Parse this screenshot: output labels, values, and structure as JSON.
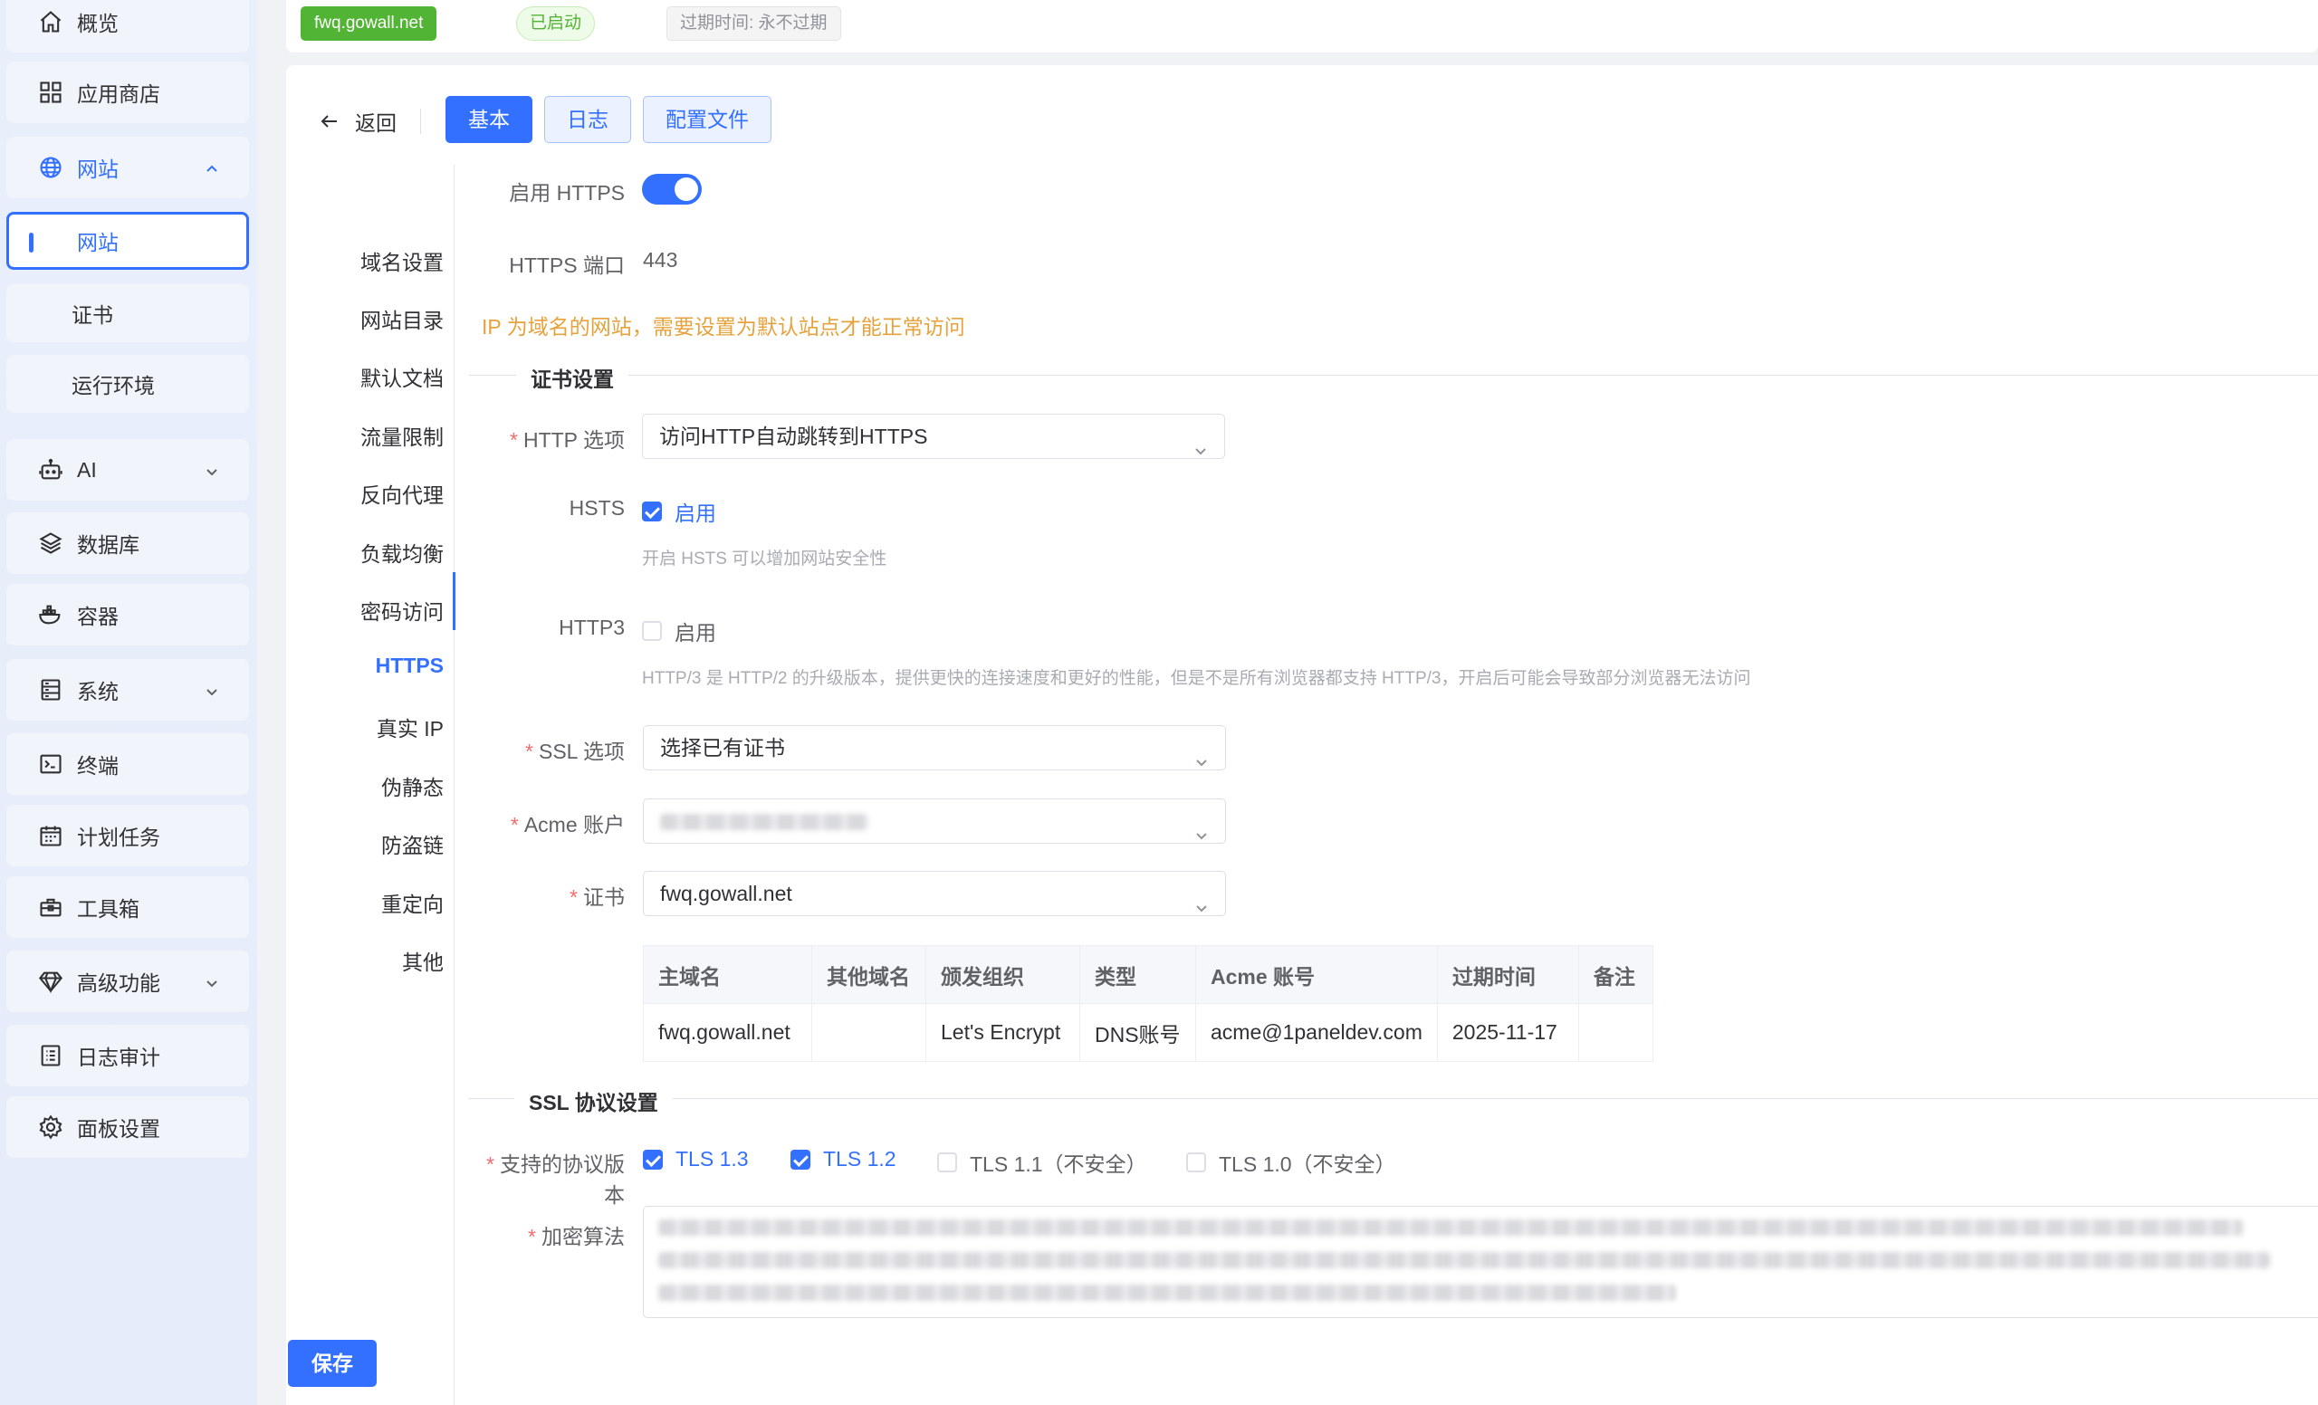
{
  "sidebar": {
    "items": [
      {
        "label": "概览",
        "icon": "home-icon"
      },
      {
        "label": "应用商店",
        "icon": "grid-icon"
      },
      {
        "label": "网站",
        "icon": "globe-icon"
      },
      {
        "label": "AI",
        "icon": "robot-icon"
      },
      {
        "label": "数据库",
        "icon": "layers-icon"
      },
      {
        "label": "容器",
        "icon": "docker-icon"
      },
      {
        "label": "系统",
        "icon": "server-icon"
      },
      {
        "label": "终端",
        "icon": "terminal-icon"
      },
      {
        "label": "计划任务",
        "icon": "calendar-icon"
      },
      {
        "label": "工具箱",
        "icon": "toolbox-icon"
      },
      {
        "label": "高级功能",
        "icon": "diamond-icon"
      },
      {
        "label": "日志审计",
        "icon": "log-icon"
      },
      {
        "label": "面板设置",
        "icon": "gear-icon"
      }
    ],
    "sub_items": [
      {
        "label": "网站"
      },
      {
        "label": "证书"
      },
      {
        "label": "运行环境"
      }
    ]
  },
  "topbar": {
    "domain": "fwq.gowall.net",
    "status": "已启动",
    "expire": "过期时间: 永不过期"
  },
  "panel": {
    "back_label": "返回",
    "tabs": [
      "基本",
      "日志",
      "配置文件"
    ],
    "subnav": [
      "域名设置",
      "网站目录",
      "默认文档",
      "流量限制",
      "反向代理",
      "负载均衡",
      "密码访问",
      "HTTPS",
      "真实 IP",
      "伪静态",
      "防盗链",
      "重定向",
      "其他"
    ],
    "active_subnav": "HTTPS"
  },
  "form": {
    "enable_https_label": "启用 HTTPS",
    "https_port_label": "HTTPS 端口",
    "https_port_value": "443",
    "ip_warning": "IP 为域名的网站，需要设置为默认站点才能正常访问",
    "cert_section_title": "证书设置",
    "http_option_label": "HTTP 选项",
    "http_option_value": "访问HTTP自动跳转到HTTPS",
    "hsts_label": "HSTS",
    "hsts_check_label": "启用",
    "hsts_hint": "开启 HSTS 可以增加网站安全性",
    "http3_label": "HTTP3",
    "http3_check_label": "启用",
    "http3_hint": "HTTP/3 是 HTTP/2 的升级版本，提供更快的连接速度和更好的性能，但是不是所有浏览器都支持 HTTP/3，开启后可能会导致部分浏览器无法访问",
    "ssl_option_label": "SSL 选项",
    "ssl_option_value": "选择已有证书",
    "acme_label": "Acme 账户",
    "cert_label": "证书",
    "cert_value": "fwq.gowall.net",
    "ssl_section_title": "SSL 协议设置",
    "protocol_label": "支持的协议版本",
    "protocols": [
      {
        "label": "TLS 1.3",
        "checked": true
      },
      {
        "label": "TLS 1.2",
        "checked": true
      },
      {
        "label": "TLS 1.1（不安全）",
        "checked": false
      },
      {
        "label": "TLS 1.0（不安全）",
        "checked": false
      }
    ],
    "cipher_label": "加密算法",
    "save_label": "保存"
  },
  "cert_table": {
    "headers": [
      "主域名",
      "其他域名",
      "颁发组织",
      "类型",
      "Acme 账号",
      "过期时间",
      "备注"
    ],
    "rows": [
      [
        "fwq.gowall.net",
        "",
        "Let's Encrypt",
        "DNS账号",
        "acme@1paneldev.com",
        "2025-11-17",
        ""
      ]
    ]
  },
  "colors": {
    "primary": "#3370ff",
    "success": "#52b434",
    "warning": "#e6a23c",
    "danger": "#f56c6c"
  }
}
